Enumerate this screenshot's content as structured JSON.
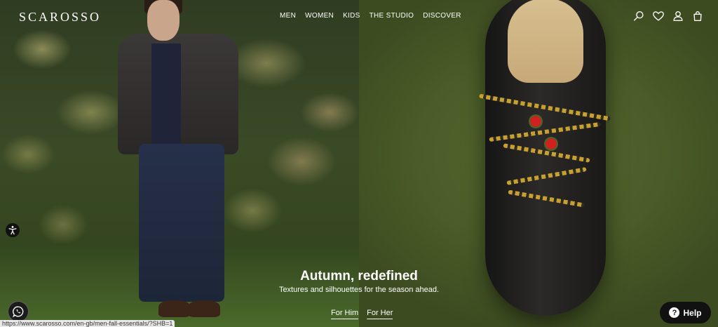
{
  "brand": {
    "logo": "SCAROSSO"
  },
  "nav": {
    "items": [
      {
        "label": "MEN"
      },
      {
        "label": "WOMEN"
      },
      {
        "label": "KIDS"
      },
      {
        "label": "THE STUDIO"
      },
      {
        "label": "DISCOVER"
      }
    ]
  },
  "header_icons": [
    "search-icon",
    "heart-icon",
    "user-icon",
    "bag-icon"
  ],
  "hero": {
    "title": "Autumn, redefined",
    "subtitle": "Textures and silhouettes for the season ahead.",
    "cta_him": "For Him",
    "cta_her": "For Her"
  },
  "help_button": {
    "label": "Help",
    "icon": "?"
  },
  "status_bar": {
    "url": "https://www.scarosso.com/en-gb/men-fall-essentials/?SHB=1"
  },
  "colors": {
    "text": "#ffffff",
    "button_bg": "#111111",
    "field_green": "#4a5c28"
  }
}
